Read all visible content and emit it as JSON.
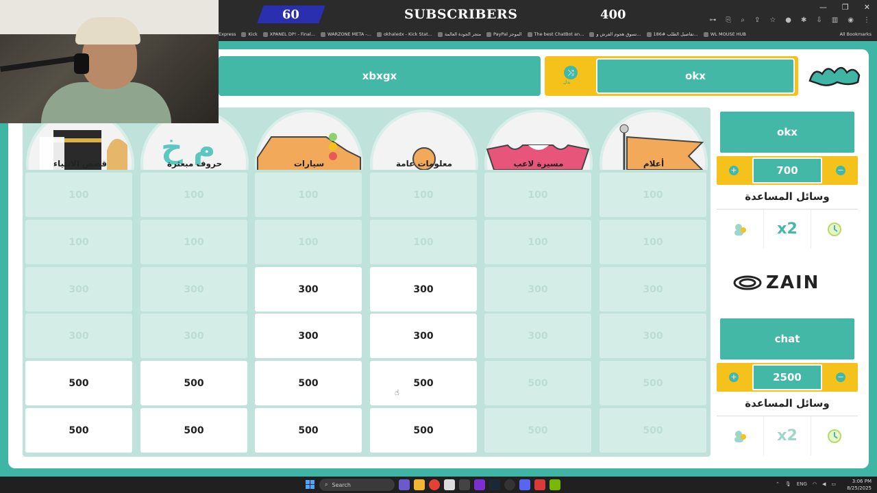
{
  "overlay": {
    "subscribers_current": "60",
    "subscribers_title": "SUBSCRIBERS",
    "subscribers_goal": "400"
  },
  "browser": {
    "bookmarks": [
      "Express",
      "Kick",
      "XPANEL DP! - Final...",
      "WARZONE META -...",
      "okhaledx - Kick Stat...",
      "متجر الجودة العالمة",
      "PayPal الموجز",
      "The best ChatBot an...",
      "تسوق هجوم الفرش و...",
      "تفاصيل الطلب #186...",
      "WL MOUSE HUB"
    ],
    "all_bookmarks": "All Bookmarks"
  },
  "game": {
    "team_left": "xbxgx",
    "team_right": "okx",
    "swap_label": "بدل",
    "categories": [
      {
        "label": "قصص الانبياء",
        "art": "kaaba"
      },
      {
        "label": "حروف مبعثرة",
        "art": "letters"
      },
      {
        "label": "سيارات",
        "art": "car"
      },
      {
        "label": "معلومات عامة",
        "art": "ball"
      },
      {
        "label": "مسيرة لاعب",
        "art": "jersey"
      },
      {
        "label": "أعلام",
        "art": "flag"
      }
    ],
    "rows": [
      [
        "100",
        "100",
        "100",
        "100",
        "100",
        "100"
      ],
      [
        "100",
        "100",
        "100",
        "100",
        "100",
        "100"
      ],
      [
        "300",
        "300",
        "300",
        "300",
        "300",
        "300"
      ],
      [
        "300",
        "300",
        "300",
        "300",
        "300",
        "300"
      ],
      [
        "500",
        "500",
        "500",
        "500",
        "500",
        "500"
      ],
      [
        "500",
        "500",
        "500",
        "500",
        "500",
        "500"
      ]
    ],
    "active": [
      [
        false,
        false,
        false,
        false,
        false,
        false
      ],
      [
        false,
        false,
        false,
        false,
        false,
        false
      ],
      [
        false,
        false,
        true,
        true,
        false,
        false
      ],
      [
        false,
        false,
        true,
        true,
        false,
        false
      ],
      [
        true,
        true,
        true,
        true,
        false,
        false
      ],
      [
        true,
        true,
        true,
        true,
        false,
        false
      ]
    ]
  },
  "sidebar": {
    "team1": {
      "name": "okx",
      "score": "700",
      "aids_title": "وسائل المساعدة",
      "plus": "+",
      "minus": "−"
    },
    "sponsor": "ZAIN",
    "team2": {
      "name": "chat",
      "score": "2500",
      "aids_title": "وسائل المساعدة",
      "plus": "+",
      "minus": "−"
    },
    "aid_x2": "x2"
  },
  "colors": {
    "teal": "#43b8a7",
    "yellow": "#f4c21b",
    "used_cell": "#d4ede7"
  },
  "taskbar": {
    "search_placeholder": "Search",
    "lang": "ENG",
    "time": "3:06 PM",
    "date": "8/25/2025"
  }
}
